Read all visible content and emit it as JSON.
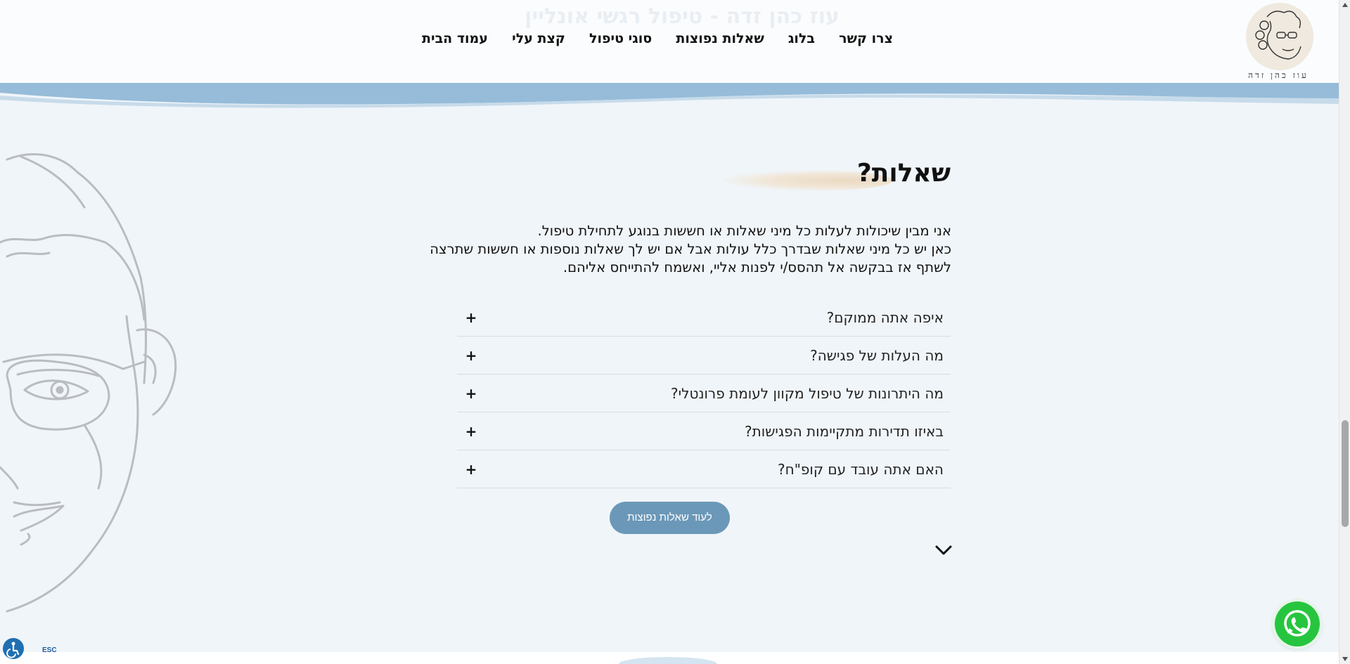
{
  "header": {
    "ghost_text": "עוז כהן זדה - טיפול רגשי אונליין",
    "logo_text": "עוז כהן זדה",
    "nav": [
      {
        "label": "עמוד הבית"
      },
      {
        "label": "קצת עלי"
      },
      {
        "label": "סוגי טיפול"
      },
      {
        "label": "שאלות נפוצות"
      },
      {
        "label": "בלוג"
      },
      {
        "label": "צרו קשר"
      }
    ]
  },
  "section": {
    "title": "שאלות?",
    "intro_lines": [
      "אני מבין שיכולות לעלות כל מיני שאלות או חששות בנוגע לתחילת טיפול.",
      "כאן יש כל מיני שאלות שבדרך כלל עולות אבל אם יש לך שאלות נוספות או חששות שתרצה",
      "לשתף אז בבקשה אל תהסס/י לפנות אליי, ואשמח להתייחס אליהם."
    ],
    "faq": [
      {
        "question": "איפה אתה ממוקם?",
        "toggle": "+"
      },
      {
        "question": "מה העלות של פגישה?",
        "toggle": "+"
      },
      {
        "question": "מה היתרונות של טיפול מקוון לעומת פרונטלי?",
        "toggle": "+"
      },
      {
        "question": "באיזו תדירות מתקיימות הפגישות?",
        "toggle": "+"
      },
      {
        "question": "האם אתה עובד עם קופ\"ח?",
        "toggle": "+"
      }
    ],
    "more_button": "לעוד שאלות נפוצות"
  },
  "widgets": {
    "esc_label": "ESC",
    "whatsapp_icon": "whatsapp-icon",
    "accessibility_icon": "accessibility-icon"
  },
  "colors": {
    "background": "#f0f5f9",
    "wave": "#96bcd9",
    "button": "#6b98b8",
    "whatsapp": "#27c53f"
  }
}
